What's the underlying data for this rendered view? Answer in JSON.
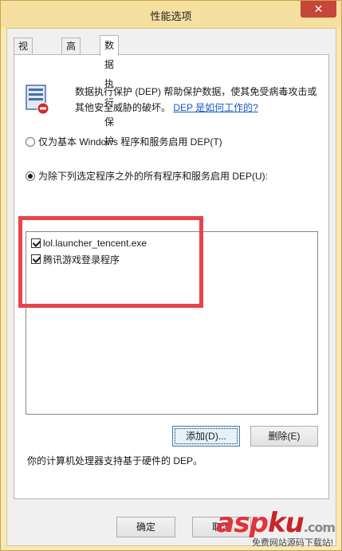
{
  "window": {
    "title": "性能选项",
    "close_glyph": "✕"
  },
  "tabs": [
    {
      "label": "视觉效果",
      "active": false
    },
    {
      "label": "高级",
      "active": false
    },
    {
      "label": "数据执行保护",
      "active": true
    }
  ],
  "dep": {
    "icon": "dep-shield-icon",
    "description_1": "数据执行保护 (DEP) 帮助保护数据，使其免受病毒攻击或",
    "description_2": "其他安全威胁的破坏。",
    "link": "DEP 是如何工作的?"
  },
  "options": [
    {
      "label": "仅为基本 Windows 程序和服务启用 DEP(T)",
      "checked": false
    },
    {
      "label": "为除下列选定程序之外的所有程序和服务启用 DEP(U):",
      "checked": true
    }
  ],
  "programs": [
    {
      "label": "lol.launcher_tencent.exe",
      "checked": true
    },
    {
      "label": "腾讯游戏登录程序",
      "checked": true
    }
  ],
  "buttons": {
    "add": "添加(D)...",
    "remove": "删除(E)",
    "ok": "确定",
    "cancel": "取消"
  },
  "hardware_text": "你的计算机处理器支持基于硬件的 DEP。",
  "watermark": {
    "main": "asp",
    "accent": "ku",
    "suffix": ".com",
    "sub": "免费网站源码下载站!"
  },
  "colors": {
    "highlight": "#e8434a",
    "link": "#1a57c7",
    "close": "#c7463a"
  }
}
